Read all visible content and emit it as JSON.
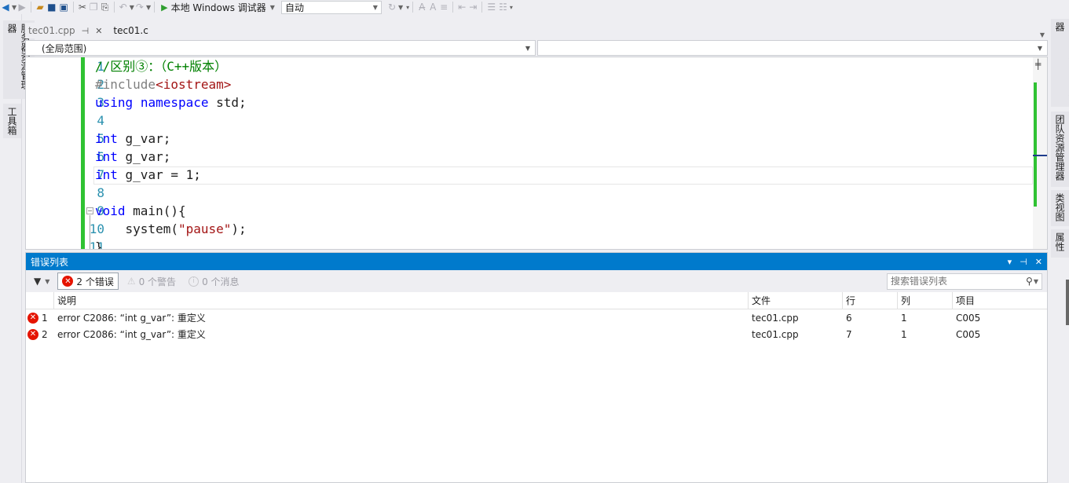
{
  "toolbar": {
    "run_label": "本地 Windows 调试器",
    "config_value": "自动"
  },
  "left_rail": {
    "tabs": [
      "服务器资源管理器",
      "工具箱"
    ]
  },
  "right_rail": {
    "tabs": [
      "解决方案资源管理器",
      "团队资源管理器",
      "类视图",
      "属性"
    ]
  },
  "editor_tabs": [
    {
      "label": "tec01.cpp",
      "active": true
    },
    {
      "label": "tec01.c",
      "active": false
    }
  ],
  "navbar": {
    "scope": "(全局范围)",
    "member": ""
  },
  "code": {
    "lines": [
      {
        "num": "1",
        "segments": [
          {
            "t": "//区别③：（C++版本）",
            "c": "cm"
          }
        ]
      },
      {
        "num": "2",
        "segments": [
          {
            "t": "#include",
            "c": "pp"
          },
          {
            "t": "<iostream>",
            "c": "st"
          }
        ]
      },
      {
        "num": "3",
        "segments": [
          {
            "t": "using",
            "c": "k"
          },
          {
            "t": " ",
            "c": ""
          },
          {
            "t": "namespace",
            "c": "k"
          },
          {
            "t": " std;",
            "c": ""
          }
        ]
      },
      {
        "num": "4",
        "segments": []
      },
      {
        "num": "5",
        "segments": [
          {
            "t": "int",
            "c": "k"
          },
          {
            "t": " g_var;",
            "c": ""
          }
        ]
      },
      {
        "num": "6",
        "segments": [
          {
            "t": "int",
            "c": "k"
          },
          {
            "t": " g_var;",
            "c": ""
          }
        ]
      },
      {
        "num": "7",
        "segments": [
          {
            "t": "int",
            "c": "k"
          },
          {
            "t": " g_var = 1;",
            "c": ""
          }
        ]
      },
      {
        "num": "8",
        "segments": []
      },
      {
        "num": "9",
        "segments": [
          {
            "t": "void",
            "c": "k"
          },
          {
            "t": " main(){",
            "c": ""
          }
        ]
      },
      {
        "num": "10",
        "segments": [
          {
            "t": "    system(",
            "c": ""
          },
          {
            "t": "\"pause\"",
            "c": "st"
          },
          {
            "t": ");",
            "c": ""
          }
        ]
      },
      {
        "num": "11",
        "segments": [
          {
            "t": "}",
            "c": ""
          }
        ]
      }
    ]
  },
  "error_list": {
    "title": "错误列表",
    "errors_toggle": "2 个错误",
    "warnings_toggle": "0 个警告",
    "messages_toggle": "0 个消息",
    "search_placeholder": "搜索错误列表",
    "columns": {
      "description": "说明",
      "file": "文件",
      "line": "行",
      "column": "列",
      "project": "项目"
    },
    "rows": [
      {
        "index": "1",
        "description": "error C2086: “int g_var”: 重定义",
        "file": "tec01.cpp",
        "line": "6",
        "column": "1",
        "project": "C005"
      },
      {
        "index": "2",
        "description": "error C2086: “int g_var”: 重定义",
        "file": "tec01.cpp",
        "line": "7",
        "column": "1",
        "project": "C005"
      }
    ]
  },
  "colors": {
    "accent": "#007acc",
    "error": "#e51400",
    "change_bar": "#2fc232",
    "keyword": "#0000ff",
    "comment": "#008000",
    "string": "#a31515",
    "line_number": "#2b91af"
  }
}
